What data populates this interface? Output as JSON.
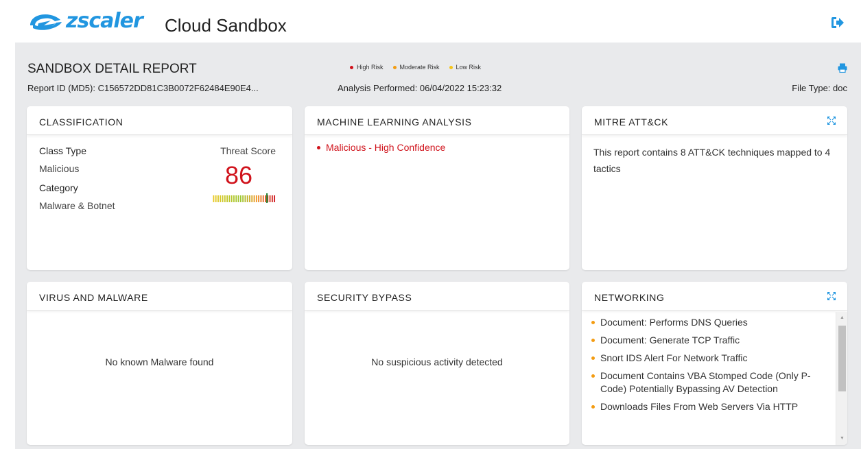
{
  "header": {
    "brand": "zscaler",
    "app_title": "Cloud Sandbox",
    "logout_icon": "logout-icon"
  },
  "report": {
    "title": "SANDBOX DETAIL REPORT",
    "report_id": "Report ID (MD5): C156572DD81C3B0072F62484E90E4...",
    "analysis": "Analysis Performed: 06/04/2022 15:23:32",
    "file_type": "File Type: doc",
    "legend": [
      {
        "label": "High Risk",
        "color": "#d0121b"
      },
      {
        "label": "Moderate Risk",
        "color": "#f39c12"
      },
      {
        "label": "Low Risk",
        "color": "#f5c518"
      }
    ]
  },
  "classification": {
    "title": "CLASSIFICATION",
    "class_type_label": "Class Type",
    "class_type_value": "Malicious",
    "category_label": "Category",
    "category_value": "Malware & Botnet",
    "threat_label": "Threat Score",
    "threat_score": "86"
  },
  "ml": {
    "title": "MACHINE LEARNING ANALYSIS",
    "result": "Malicious - High Confidence"
  },
  "mitre": {
    "title": "MITRE ATT&CK",
    "text": "This report contains 8 ATT&CK techniques mapped to 4 tactics"
  },
  "virus": {
    "title": "VIRUS AND MALWARE",
    "message": "No known Malware found"
  },
  "bypass": {
    "title": "SECURITY BYPASS",
    "message": "No suspicious activity detected"
  },
  "networking": {
    "title": "NETWORKING",
    "items": [
      "Document: Performs DNS Queries",
      "Document: Generate TCP Traffic",
      "Snort IDS Alert For Network Traffic",
      "Document Contains VBA Stomped Code (Only P-Code) Potentially Bypassing AV Detection",
      "Downloads Files From Web Servers Via HTTP"
    ]
  },
  "colors": {
    "brand_blue": "#2196e0",
    "high_risk": "#d0121b",
    "moderate_risk": "#f39c12",
    "background": "#e9eaec"
  }
}
